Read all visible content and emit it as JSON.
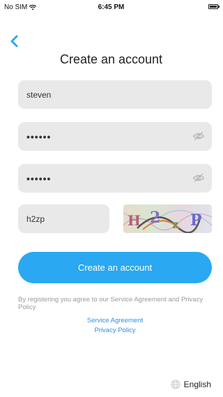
{
  "status_bar": {
    "carrier": "No SIM",
    "time": "6:45 PM"
  },
  "header": {
    "title": "Create an account",
    "back_icon": "chevron-left-icon"
  },
  "form": {
    "username_value": "steven",
    "password_value": "••••••",
    "confirm_password_value": "••••••",
    "captcha_value": "h2zp",
    "captcha_image_text": "H2zP",
    "visibility_icon": "eye-off-icon",
    "submit_label": "Create an account"
  },
  "terms": {
    "text": "By registering you agree to our Service Agreement and Privacy Policy",
    "service_agreement_link": "Service Agreement",
    "privacy_policy_link": "Privacy Policy"
  },
  "footer": {
    "language_label": "English",
    "language_icon": "globe-icon"
  },
  "colors": {
    "accent": "#2aa8f1",
    "link": "#2b8fe6",
    "field_bg": "#e9e9e9",
    "muted_text": "#9a9a9a"
  }
}
